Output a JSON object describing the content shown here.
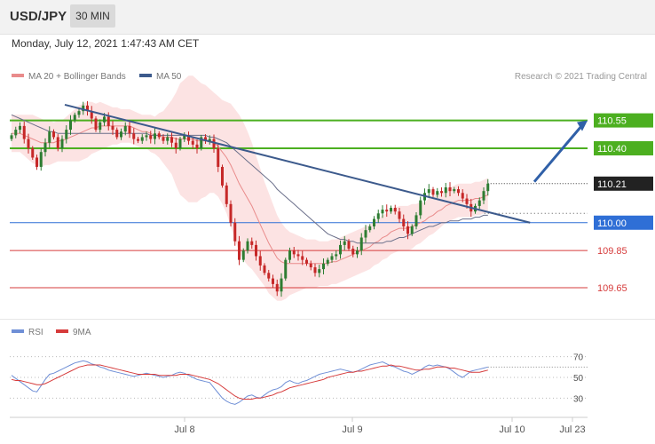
{
  "header": {
    "symbol": "USD/JPY",
    "timeframe": "30 MIN",
    "datetime": "Monday, July 12, 2021 1:47:43 AM CET"
  },
  "legend": {
    "items": [
      {
        "label": "MA 20 + Bollinger Bands",
        "color": "#e98b8b"
      },
      {
        "label": "MA 50",
        "color": "#3c5a8c"
      }
    ],
    "copyright": "Research © 2021 Trading Central"
  },
  "rsi_legend": {
    "items": [
      {
        "label": "RSI",
        "color": "#6f8fd6"
      },
      {
        "label": "9MA",
        "color": "#d63b3b"
      }
    ]
  },
  "chart_data": [
    {
      "type": "candlestick",
      "title": "USD/JPY 30 MIN",
      "x_ticks": [
        "Jul 8",
        "Jul 9",
        "Jul 10",
        "Jul 23"
      ],
      "ylim": [
        109.55,
        110.72
      ],
      "price_levels": [
        {
          "label": "110.55",
          "value": 110.55,
          "kind": "resistance",
          "color": "#4caf20"
        },
        {
          "label": "110.40",
          "value": 110.4,
          "kind": "resistance",
          "color": "#4caf20"
        },
        {
          "label": "110.21",
          "value": 110.21,
          "kind": "last",
          "color": "#222222"
        },
        {
          "label": "110.00",
          "value": 110.0,
          "kind": "pivot",
          "color": "#2f6fd6"
        },
        {
          "label": "109.85",
          "value": 109.85,
          "kind": "support",
          "color": "#d63b3b"
        },
        {
          "label": "109.65",
          "value": 109.65,
          "kind": "support",
          "color": "#d63b3b"
        }
      ],
      "closes": [
        110.47,
        110.5,
        110.52,
        110.45,
        110.4,
        110.35,
        110.3,
        110.38,
        110.43,
        110.49,
        110.46,
        110.4,
        110.45,
        110.5,
        110.55,
        110.58,
        110.6,
        110.63,
        110.6,
        110.56,
        110.5,
        110.54,
        110.57,
        110.52,
        110.5,
        110.46,
        110.49,
        110.52,
        110.48,
        110.45,
        110.44,
        110.46,
        110.47,
        110.45,
        110.48,
        110.46,
        110.44,
        110.46,
        110.43,
        110.4,
        110.45,
        110.47,
        110.44,
        110.42,
        110.4,
        110.46,
        110.44,
        110.45,
        110.4,
        110.3,
        110.2,
        110.1,
        110.0,
        109.9,
        109.8,
        109.85,
        109.9,
        109.88,
        109.82,
        109.77,
        109.73,
        109.7,
        109.67,
        109.63,
        109.7,
        109.8,
        109.85,
        109.83,
        109.82,
        109.8,
        109.78,
        109.76,
        109.73,
        109.75,
        109.78,
        109.8,
        109.82,
        109.83,
        109.88,
        109.9,
        109.86,
        109.83,
        109.85,
        109.92,
        109.96,
        109.98,
        110.02,
        110.05,
        110.07,
        110.06,
        110.08,
        110.06,
        110.02,
        109.98,
        109.94,
        109.98,
        110.04,
        110.12,
        110.16,
        110.18,
        110.15,
        110.17,
        110.16,
        110.19,
        110.17,
        110.18,
        110.16,
        110.13,
        110.1,
        110.06,
        110.09,
        110.12,
        110.17,
        110.21
      ],
      "ma20": [
        110.48,
        110.48,
        110.48,
        110.47,
        110.46,
        110.45,
        110.44,
        110.43,
        110.43,
        110.43,
        110.43,
        110.44,
        110.44,
        110.45,
        110.46,
        110.47,
        110.48,
        110.49,
        110.5,
        110.51,
        110.51,
        110.52,
        110.52,
        110.52,
        110.52,
        110.52,
        110.52,
        110.52,
        110.52,
        110.51,
        110.5,
        110.49,
        110.49,
        110.48,
        110.47,
        110.47,
        110.46,
        110.46,
        110.46,
        110.45,
        110.45,
        110.45,
        110.45,
        110.45,
        110.44,
        110.44,
        110.44,
        110.44,
        110.43,
        110.41,
        110.38,
        110.35,
        110.31,
        110.26,
        110.21,
        110.17,
        110.13,
        110.09,
        110.04,
        109.99,
        109.94,
        109.89,
        109.85,
        109.81,
        109.79,
        109.78,
        109.78,
        109.78,
        109.78,
        109.78,
        109.78,
        109.78,
        109.78,
        109.78,
        109.78,
        109.78,
        109.79,
        109.79,
        109.8,
        109.81,
        109.82,
        109.83,
        109.84,
        109.85,
        109.86,
        109.87,
        109.89,
        109.9,
        109.92,
        109.93,
        109.95,
        109.96,
        109.97,
        109.97,
        109.97,
        109.98,
        109.99,
        110.0,
        110.01,
        110.03,
        110.04,
        110.06,
        110.07,
        110.09,
        110.1,
        110.11,
        110.12,
        110.12,
        110.12,
        110.12,
        110.13,
        110.13,
        110.14,
        110.15
      ],
      "ma50": [
        110.58,
        110.57,
        110.56,
        110.55,
        110.54,
        110.53,
        110.52,
        110.51,
        110.5,
        110.49,
        110.49,
        110.48,
        110.48,
        110.48,
        110.48,
        110.48,
        110.48,
        110.48,
        110.48,
        110.48,
        110.48,
        110.48,
        110.48,
        110.48,
        110.48,
        110.48,
        110.48,
        110.48,
        110.48,
        110.48,
        110.48,
        110.48,
        110.48,
        110.47,
        110.47,
        110.47,
        110.47,
        110.47,
        110.47,
        110.47,
        110.47,
        110.47,
        110.47,
        110.47,
        110.47,
        110.47,
        110.47,
        110.46,
        110.46,
        110.45,
        110.44,
        110.43,
        110.41,
        110.39,
        110.37,
        110.35,
        110.33,
        110.31,
        110.29,
        110.27,
        110.25,
        110.23,
        110.21,
        110.18,
        110.16,
        110.14,
        110.12,
        110.1,
        110.08,
        110.06,
        110.04,
        110.02,
        110.0,
        109.98,
        109.96,
        109.94,
        109.93,
        109.92,
        109.91,
        109.91,
        109.9,
        109.9,
        109.89,
        109.89,
        109.89,
        109.89,
        109.89,
        109.89,
        109.89,
        109.9,
        109.9,
        109.91,
        109.92,
        109.92,
        109.93,
        109.94,
        109.95,
        109.96,
        109.97,
        109.98,
        109.98,
        109.99,
        110.0,
        110.0,
        110.01,
        110.01,
        110.01,
        110.02,
        110.02,
        110.02,
        110.03,
        110.03,
        110.04,
        110.04
      ],
      "bb_width": [
        0.1,
        0.1,
        0.1,
        0.11,
        0.12,
        0.13,
        0.13,
        0.13,
        0.12,
        0.12,
        0.11,
        0.11,
        0.11,
        0.12,
        0.13,
        0.14,
        0.15,
        0.15,
        0.15,
        0.14,
        0.13,
        0.13,
        0.12,
        0.11,
        0.1,
        0.1,
        0.09,
        0.09,
        0.09,
        0.09,
        0.09,
        0.09,
        0.09,
        0.1,
        0.1,
        0.12,
        0.14,
        0.17,
        0.2,
        0.25,
        0.3,
        0.32,
        0.34,
        0.34,
        0.33,
        0.31,
        0.3,
        0.28,
        0.27,
        0.27,
        0.28,
        0.3,
        0.33,
        0.35,
        0.37,
        0.37,
        0.36,
        0.34,
        0.32,
        0.3,
        0.28,
        0.27,
        0.25,
        0.23,
        0.21,
        0.19,
        0.17,
        0.16,
        0.15,
        0.14,
        0.13,
        0.13,
        0.13,
        0.12,
        0.12,
        0.12,
        0.12,
        0.12,
        0.12,
        0.12,
        0.12,
        0.12,
        0.12,
        0.12,
        0.12,
        0.12,
        0.12,
        0.12,
        0.12,
        0.12,
        0.12,
        0.12,
        0.12,
        0.12,
        0.12,
        0.12,
        0.11,
        0.11,
        0.1,
        0.1,
        0.1,
        0.1,
        0.09,
        0.09,
        0.09,
        0.09,
        0.09,
        0.09,
        0.09,
        0.09,
        0.09,
        0.09,
        0.09,
        0.09
      ],
      "trendline": {
        "from": [
          0,
          110.62
        ],
        "to": [
          123,
          110.0
        ],
        "color": "#3c5a8c"
      },
      "forecast_arrow": {
        "from": [
          124,
          110.22
        ],
        "to": [
          139,
          110.55
        ],
        "color": "#3060a8"
      }
    },
    {
      "type": "line",
      "title": "RSI",
      "ylim": [
        20,
        80
      ],
      "y_ticks": [
        "70",
        "50",
        "30"
      ],
      "series": [
        {
          "name": "RSI",
          "color": "#6f8fd6",
          "values": [
            52,
            49,
            46,
            43,
            40,
            37,
            36,
            42,
            48,
            53,
            54,
            56,
            58,
            60,
            62,
            64,
            65,
            66,
            65,
            63,
            62,
            60,
            59,
            57,
            56,
            55,
            54,
            53,
            52,
            51,
            52,
            53,
            54,
            53,
            52,
            51,
            50,
            51,
            52,
            54,
            55,
            54,
            52,
            50,
            48,
            47,
            46,
            45,
            40,
            35,
            30,
            27,
            25,
            24,
            26,
            29,
            32,
            33,
            31,
            30,
            33,
            36,
            38,
            39,
            41,
            45,
            47,
            45,
            44,
            46,
            47,
            49,
            51,
            53,
            54,
            55,
            56,
            57,
            58,
            57,
            56,
            55,
            56,
            58,
            60,
            62,
            63,
            64,
            65,
            63,
            61,
            60,
            58,
            56,
            55,
            53,
            55,
            57,
            60,
            62,
            61,
            62,
            61,
            60,
            58,
            55,
            52,
            50,
            53,
            56,
            57,
            58,
            59,
            60
          ]
        },
        {
          "name": "9MA",
          "color": "#d63b3b",
          "values": [
            48,
            47,
            47,
            46,
            45,
            44,
            43,
            43,
            44,
            46,
            48,
            50,
            52,
            54,
            56,
            58,
            60,
            61,
            62,
            62,
            62,
            62,
            61,
            60,
            59,
            58,
            57,
            56,
            55,
            54,
            53,
            53,
            53,
            53,
            53,
            52,
            52,
            52,
            52,
            52,
            53,
            53,
            53,
            52,
            51,
            50,
            49,
            48,
            46,
            44,
            41,
            38,
            35,
            32,
            30,
            29,
            29,
            29,
            30,
            30,
            31,
            32,
            33,
            35,
            36,
            38,
            40,
            41,
            42,
            43,
            44,
            45,
            46,
            47,
            48,
            50,
            51,
            52,
            53,
            54,
            55,
            55,
            56,
            56,
            57,
            58,
            59,
            60,
            61,
            61,
            62,
            61,
            61,
            60,
            59,
            58,
            57,
            57,
            58,
            58,
            59,
            60,
            60,
            60,
            59,
            59,
            58,
            57,
            56,
            55,
            55,
            55,
            56,
            57
          ]
        }
      ]
    }
  ]
}
